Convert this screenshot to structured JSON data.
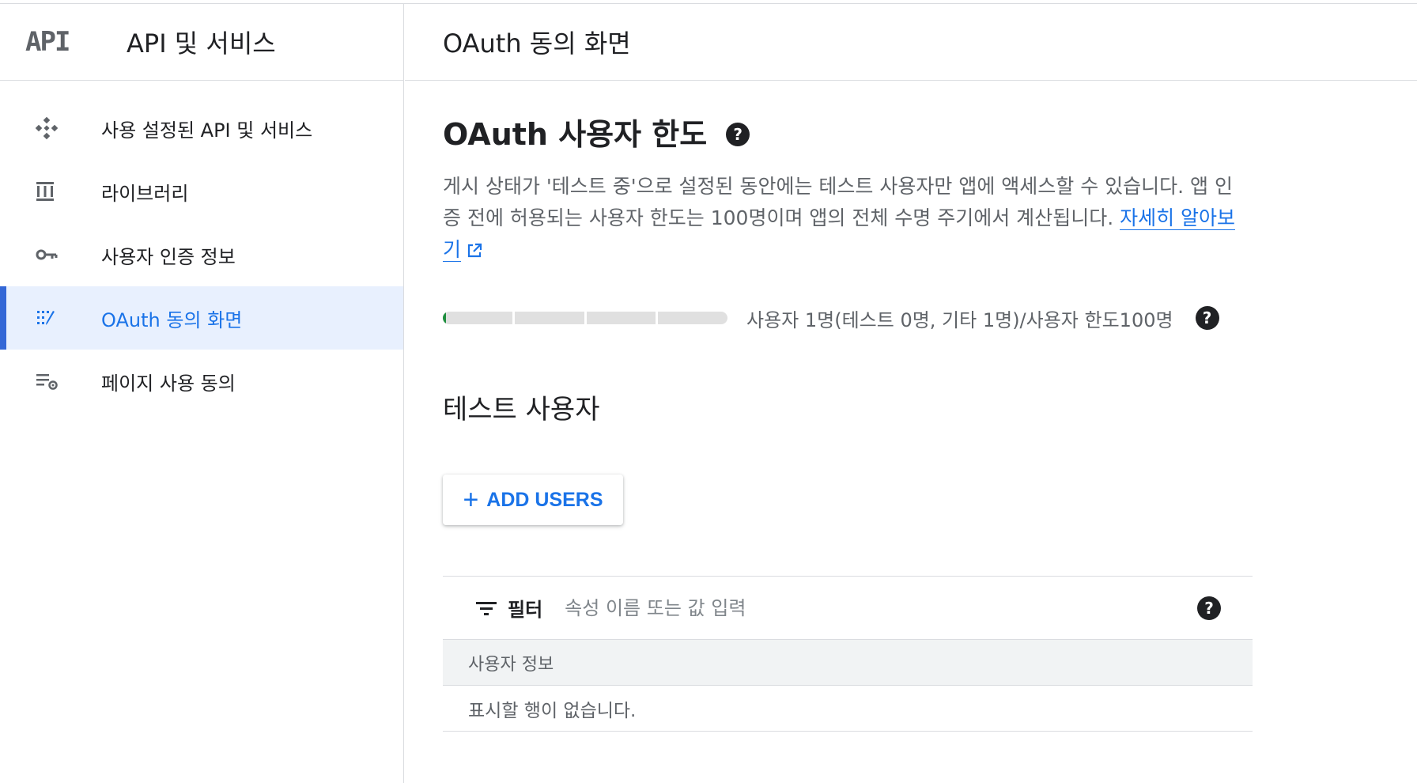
{
  "sidebar": {
    "logo_text": "API",
    "title": "API 및 서비스",
    "items": [
      {
        "label": "사용 설정된 API 및 서비스",
        "icon": "api-diamond-icon",
        "active": false
      },
      {
        "label": "라이브러리",
        "icon": "library-icon",
        "active": false
      },
      {
        "label": "사용자 인증 정보",
        "icon": "key-icon",
        "active": false
      },
      {
        "label": "OAuth 동의 화면",
        "icon": "oauth-consent-icon",
        "active": true
      },
      {
        "label": "페이지 사용 동의",
        "icon": "settings-list-icon",
        "active": false
      }
    ]
  },
  "header": {
    "title": "OAuth 동의 화면"
  },
  "main": {
    "limit_title": "OAuth 사용자 한도",
    "description": "게시 상태가 '테스트 중'으로 설정된 동안에는 테스트 사용자만 앱에 액세스할 수 있습니다. 앱 인증 전에 허용되는 사용자 한도는 100명이며 앱의 전체 수명 주기에서 계산됩니다. ",
    "learn_more": "자세히 알아보기",
    "quota": {
      "text": "사용자 1명(테스트 0명, 기타 1명)/사용자 한도100명",
      "used": 1,
      "limit": 100
    },
    "test_users_title": "테스트 사용자",
    "add_users_label": "ADD USERS",
    "filter": {
      "label": "필터",
      "placeholder": "속성 이름 또는 값 입력"
    },
    "table": {
      "column_header": "사용자 정보",
      "empty_message": "표시할 행이 없습니다."
    }
  },
  "colors": {
    "accent": "#1a73e8",
    "active_bg": "#e8f0fe",
    "progress_fill": "#1e8e3e"
  }
}
